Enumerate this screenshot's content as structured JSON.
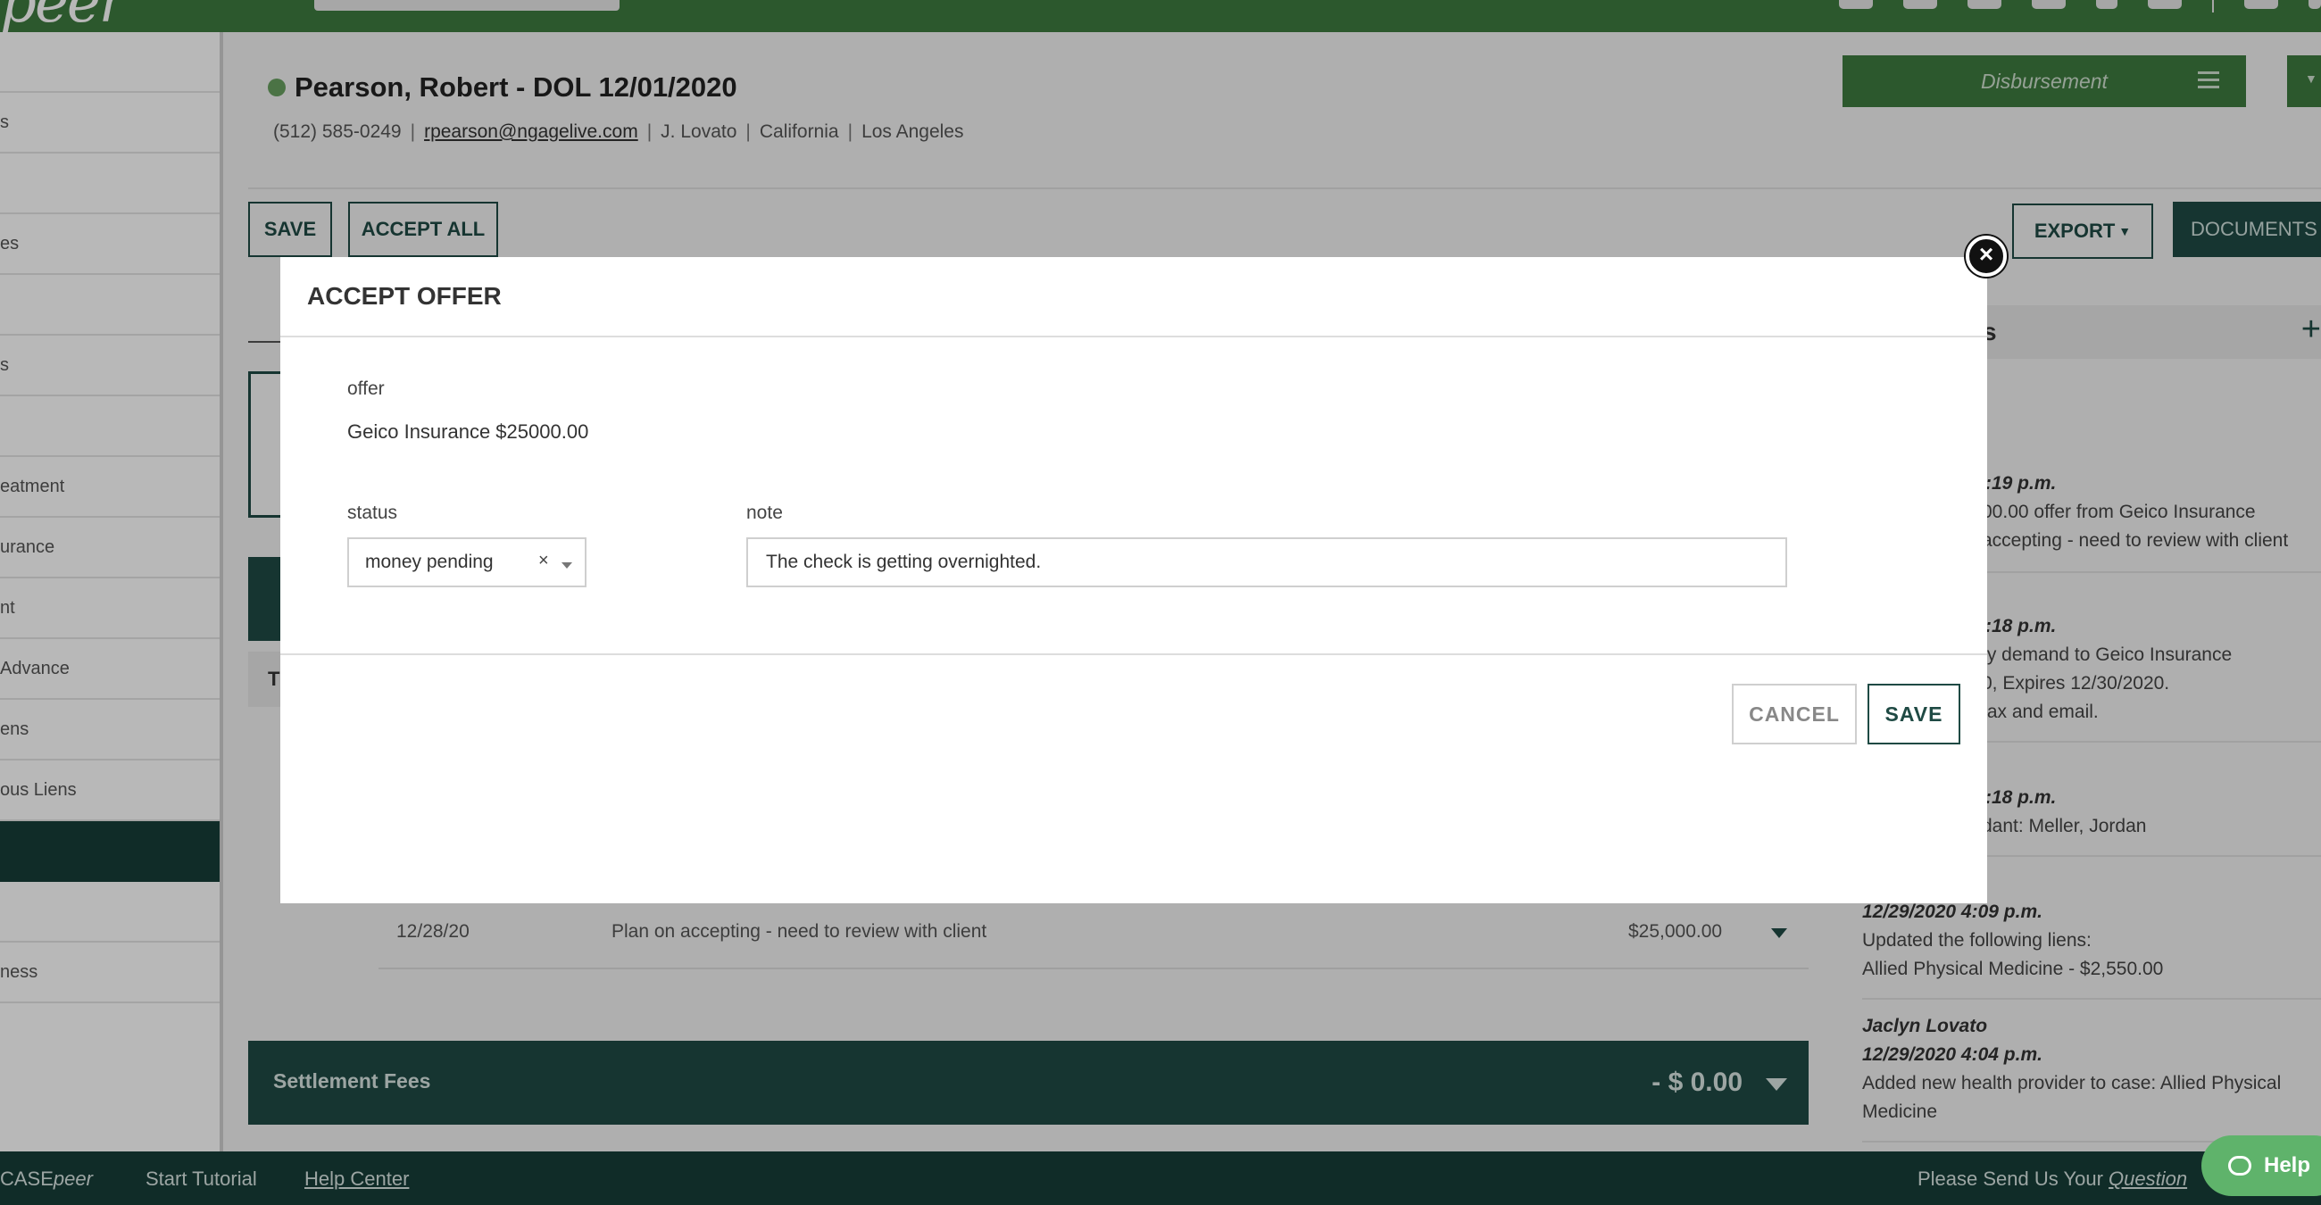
{
  "header": {
    "logo_text": "peer",
    "status_color": "#68a060",
    "case_title": "Pearson, Robert - DOL 12/01/2020",
    "phone": "(512) 585-0249",
    "email": "rpearson@ngagelive.com",
    "attorney": "J. Lovato",
    "state": "California",
    "city": "Los Angeles",
    "stage_label": "Disbursement",
    "buttons": {
      "save": "SAVE",
      "accept_all": "ACCEPT ALL",
      "export": "EXPORT",
      "documents": "DOCUMENTS"
    }
  },
  "sidebar": {
    "items": [
      {
        "label": ""
      },
      {
        "label": "s"
      },
      {
        "label": ""
      },
      {
        "label": "es"
      },
      {
        "label": ""
      },
      {
        "label": "s"
      },
      {
        "label": ""
      },
      {
        "label": "eatment"
      },
      {
        "label": "urance"
      },
      {
        "label": "nt"
      },
      {
        "label": " Advance"
      },
      {
        "label": "ens"
      },
      {
        "label": "ous Liens"
      },
      {
        "label": "",
        "active": true
      },
      {
        "label": ""
      },
      {
        "label": "ness"
      }
    ]
  },
  "activity": {
    "header_fragment": "s",
    "items": [
      {
        "who": "",
        "when": ":19 p.m.",
        "lines": [
          "00.00 offer from Geico Insurance",
          "accepting - need to review with client"
        ]
      },
      {
        "who": "",
        "when": ":18 p.m.",
        "lines": [
          "ty demand to Geico Insurance",
          "0, Expires 12/30/2020.",
          "fax and email."
        ]
      },
      {
        "who": "",
        "when": ":18 p.m.",
        "lines": [
          "dant: Meller, Jordan"
        ]
      },
      {
        "who": "",
        "when": "12/29/2020 4:09 p.m.",
        "lines": [
          "Updated the following liens:",
          "Allied Physical Medicine - $2,550.00"
        ]
      },
      {
        "who": "Jaclyn Lovato",
        "when": "12/29/2020 4:04 p.m.",
        "lines": [
          "Added new health provider to case: Allied Physical",
          "Medicine"
        ]
      }
    ]
  },
  "table": {
    "header_fragment": "T",
    "row": {
      "date": "12/28/20",
      "note": "Plan on accepting - need to review with client",
      "amount": "$25,000.00"
    }
  },
  "fees": {
    "label": "Settlement Fees",
    "amount": "- $ 0.00"
  },
  "footer": {
    "brand_prefix": "CASE",
    "brand_suffix": "peer",
    "tutorial": "Start Tutorial",
    "help_center": "Help Center",
    "send_prefix": "Please Send Us Your ",
    "send_link": "Question",
    "help_button": "Help"
  },
  "modal": {
    "title": "ACCEPT OFFER",
    "offer_label": "offer",
    "offer_value": "Geico Insurance $25000.00",
    "status_label": "status",
    "status_value": "money pending",
    "note_label": "note",
    "note_value": "The check is getting overnighted.",
    "cancel": "CANCEL",
    "save": "SAVE",
    "close": "×"
  },
  "colors": {
    "brand_green": "#3d7a3f",
    "dark_teal": "#1f4a44",
    "help_green": "#5fb36b"
  }
}
